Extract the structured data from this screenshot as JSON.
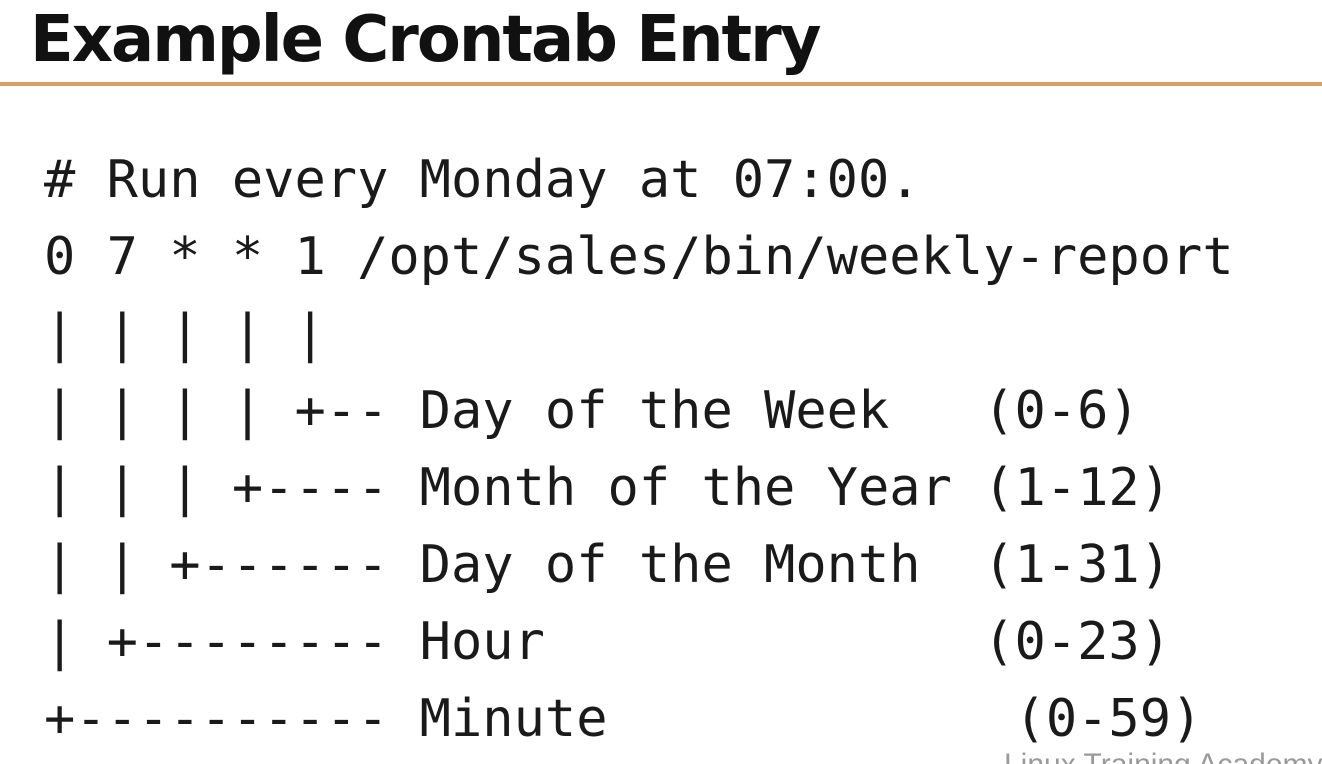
{
  "slide": {
    "title": "Example Crontab Entry"
  },
  "code": {
    "lines": [
      "# Run every Monday at 07:00.",
      "0 7 * * 1 /opt/sales/bin/weekly-report",
      "| | | | |",
      "| | | | +-- Day of the Week   (0-6)",
      "| | | +---- Month of the Year (1-12)",
      "| | +------ Day of the Month  (1-31)",
      "| +-------- Hour              (0-23)",
      "+---------- Minute             (0-59)"
    ]
  },
  "watermark": {
    "text": "Linux Training Academy"
  },
  "colors": {
    "title_rule": "#d9a066",
    "text": "#111111"
  }
}
